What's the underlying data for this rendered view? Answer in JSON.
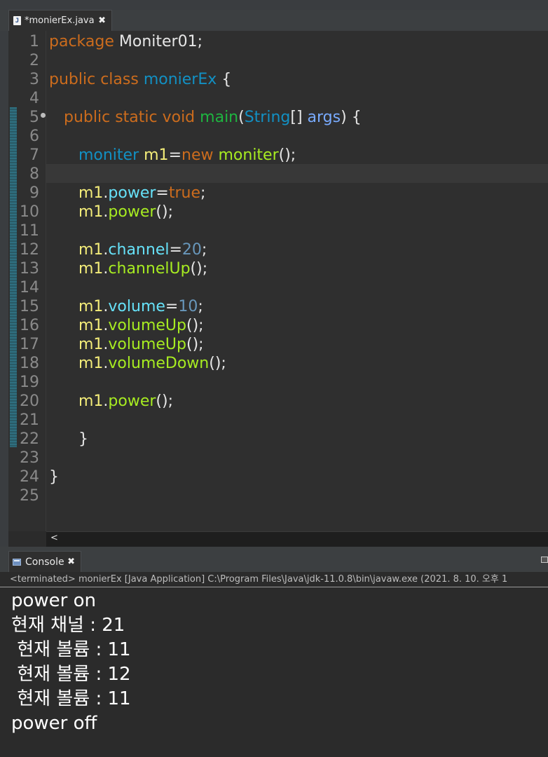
{
  "editor": {
    "tab": {
      "title": "*monierEx.java",
      "icon": "java-file-icon",
      "close": "✖"
    },
    "line_numbers": [
      "1",
      "2",
      "3",
      "4",
      "5",
      "6",
      "7",
      "8",
      "9",
      "10",
      "11",
      "12",
      "13",
      "14",
      "15",
      "16",
      "17",
      "18",
      "19",
      "20",
      "21",
      "22",
      "23",
      "24",
      "25"
    ],
    "code_lines": [
      "package Moniter01;",
      "",
      "public class monierEx {",
      "",
      "    public static void main(String[] args) {",
      "",
      "        moniter m1=new moniter();",
      "",
      "        m1.power=true;",
      "        m1.power();",
      "",
      "        m1.channel=20;",
      "        m1.channelUp();",
      "",
      "        m1.volume=10;",
      "        m1.volumeUp();",
      "        m1.volumeUp();",
      "        m1.volumeDown();",
      "",
      "        m1.power();",
      "",
      "        }",
      "",
      "}",
      ""
    ],
    "scroll_left_label": "<"
  },
  "console": {
    "tab_title": "Console",
    "close": "✖",
    "status": "<terminated> monierEx [Java Application] C:\\Program Files\\Java\\jdk-11.0.8\\bin\\javaw.exe  (2021. 8. 10. 오후 1",
    "output": [
      "power on",
      "현재 채널 : 21",
      " 현재 볼륨 : 11",
      " 현재 볼륨 : 12",
      " 현재 볼륨 : 11",
      "power off"
    ]
  },
  "colors": {
    "keyword": "#cc6c1d",
    "class": "#1290c3",
    "method": "#a7ec21",
    "field": "#66e1f8",
    "local_var": "#f3ec79",
    "number": "#6897bb",
    "background": "#2f2f2f"
  }
}
